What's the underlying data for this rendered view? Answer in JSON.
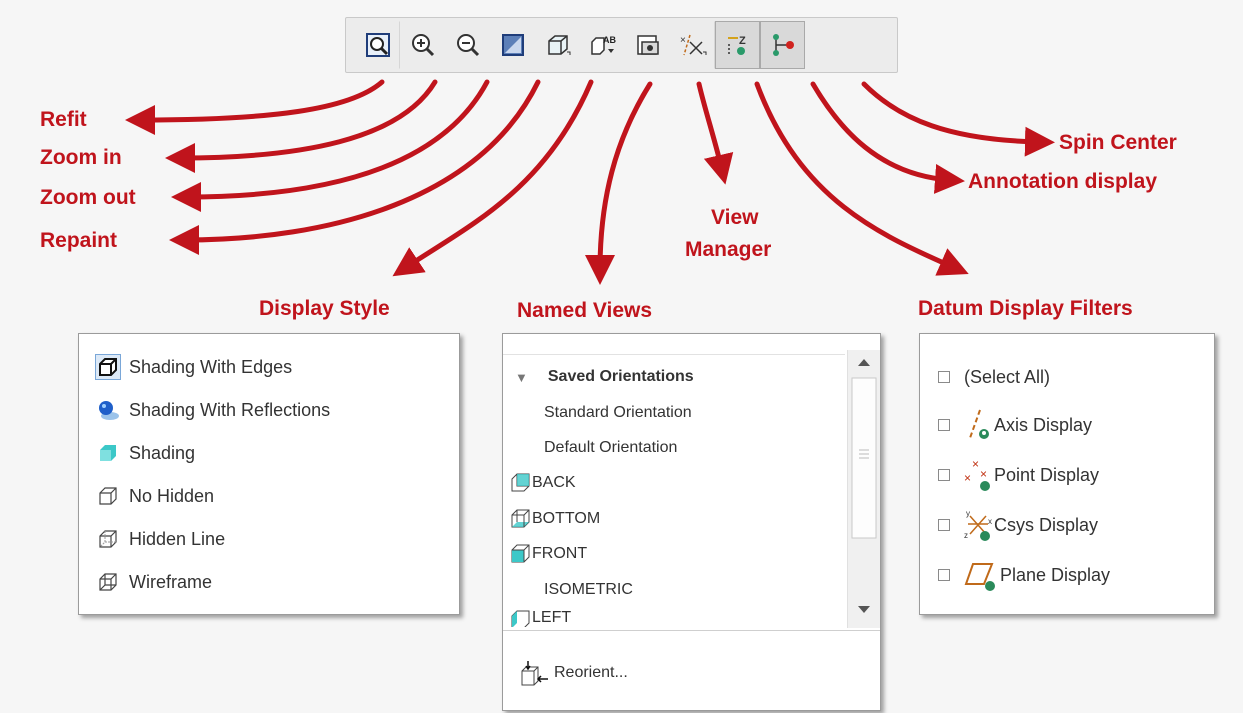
{
  "toolbar": {
    "buttons": [
      {
        "name": "refit",
        "icon": "refit-icon"
      },
      {
        "name": "zoom-in",
        "icon": "zoom-in-icon"
      },
      {
        "name": "zoom-out",
        "icon": "zoom-out-icon"
      },
      {
        "name": "repaint",
        "icon": "repaint-icon"
      },
      {
        "name": "display-style",
        "icon": "display-style-icon"
      },
      {
        "name": "named-views",
        "icon": "named-views-icon"
      },
      {
        "name": "view-manager",
        "icon": "view-manager-icon"
      },
      {
        "name": "datum-display-filters",
        "icon": "datum-filter-icon"
      },
      {
        "name": "annotation-display",
        "icon": "annotation-display-icon"
      },
      {
        "name": "spin-center",
        "icon": "spin-center-icon"
      }
    ]
  },
  "callouts": {
    "refit": "Refit",
    "zoom_in": "Zoom in",
    "zoom_out": "Zoom out",
    "repaint": "Repaint",
    "view_manager_1": "View",
    "view_manager_2": "Manager",
    "spin_center": "Spin Center",
    "annotation_display": "Annotation display",
    "display_style": "Display Style",
    "named_views": "Named Views",
    "datum_display_filters": "Datum Display Filters"
  },
  "display_style": {
    "items": [
      {
        "label": "Shading With Edges",
        "icon": "shading-edges-icon",
        "selected": true
      },
      {
        "label": "Shading With Reflections",
        "icon": "shading-reflections-icon"
      },
      {
        "label": "Shading",
        "icon": "shading-icon"
      },
      {
        "label": "No Hidden",
        "icon": "no-hidden-icon"
      },
      {
        "label": "Hidden Line",
        "icon": "hidden-line-icon"
      },
      {
        "label": "Wireframe",
        "icon": "wireframe-icon"
      }
    ]
  },
  "named_views": {
    "group": "Saved Orientations",
    "items": [
      "Standard Orientation",
      "Default Orientation",
      "BACK",
      "BOTTOM",
      "FRONT",
      "ISOMETRIC",
      "LEFT"
    ],
    "reorient": "Reorient..."
  },
  "datum_filters": {
    "items": [
      {
        "label": "(Select All)",
        "icon": ""
      },
      {
        "label": "Axis Display",
        "icon": "axis-display-icon"
      },
      {
        "label": "Point Display",
        "icon": "point-display-icon"
      },
      {
        "label": "Csys Display",
        "icon": "csys-display-icon"
      },
      {
        "label": "Plane Display",
        "icon": "plane-display-icon"
      }
    ]
  },
  "colors": {
    "callout": "#c0141c",
    "selection": "#dce9f7",
    "cyan": "#33c7c7"
  }
}
